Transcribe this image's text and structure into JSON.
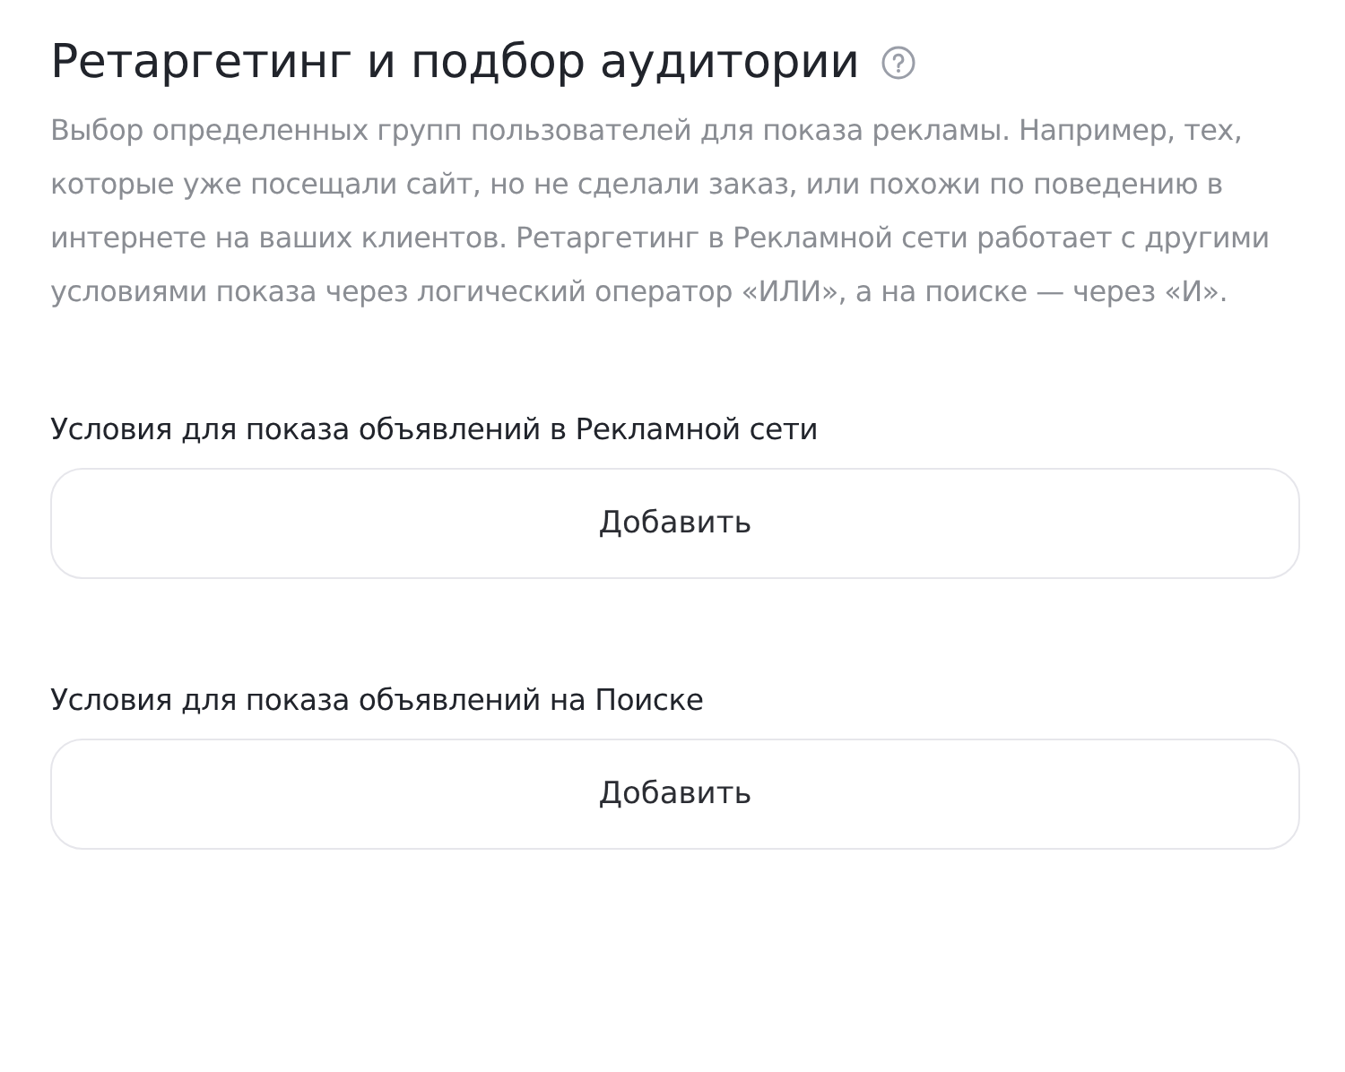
{
  "title": "Ретаргетинг и подбор аудитории",
  "description": "Выбор определенных групп пользователей для показа рекламы. Например, тех, которые уже посещали сайт, но не сделали заказ, или похожи по поведению в интернете на ваших клиентов. Ретаргетинг в Рекламной сети работает с другими условиями показа через логический оператор «ИЛИ», а на поиске — через «И».",
  "sections": [
    {
      "label": "Условия для показа объявлений в Рекламной сети",
      "button": "Добавить"
    },
    {
      "label": "Условия для показа объявлений на Поиске",
      "button": "Добавить"
    }
  ]
}
